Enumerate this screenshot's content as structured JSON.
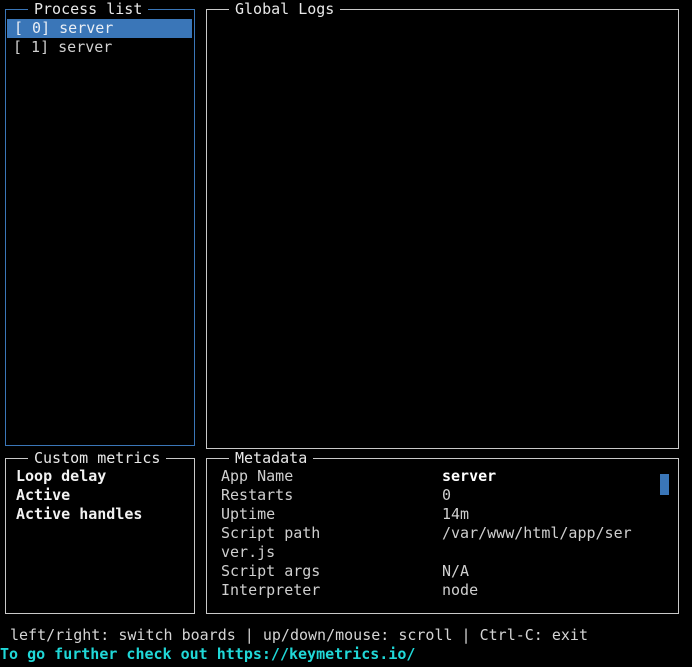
{
  "app": {
    "name": "pm2 monit",
    "theme": {
      "background": "#000000",
      "foreground": "#cfcfcf",
      "border": "#c9c9c9",
      "focus_border": "#3a76b8",
      "selection": "#3a76b8",
      "accent_cyan": "#20d8d8",
      "bold_white": "#ffffff"
    }
  },
  "process_list": {
    "title": "Process list",
    "focused": true,
    "rows": [
      {
        "label": "[ 0] server",
        "selected": true
      },
      {
        "label": "[ 1] server",
        "selected": false
      }
    ]
  },
  "global_logs": {
    "title": "Global Logs",
    "focused": false,
    "lines": []
  },
  "custom_metrics": {
    "title": "Custom metrics",
    "focused": false,
    "rows": [
      {
        "label": "Loop delay"
      },
      {
        "label": "Active"
      },
      {
        "label": "Active handles"
      }
    ]
  },
  "metadata": {
    "title": "Metadata",
    "focused": false,
    "scrollbar": {
      "visible": true,
      "color": "#3a76b8"
    },
    "rows": [
      {
        "label": "App Name",
        "value": "server",
        "bold": true
      },
      {
        "label": "Restarts",
        "value": "0",
        "bold": false
      },
      {
        "label": "Uptime",
        "value": "14m",
        "bold": false
      },
      {
        "label": "Script path",
        "value": "/var/www/html/app/ser",
        "bold": false
      },
      {
        "wrap": "ver.js"
      },
      {
        "label": "Script args",
        "value": "N/A",
        "bold": false
      },
      {
        "label": "Interpreter",
        "value": "node",
        "bold": false
      }
    ]
  },
  "footer": {
    "help": "left/right: switch boards | up/down/mouse: scroll | Ctrl-C: exit",
    "link": "To go further check out https://keymetrics.io/"
  }
}
